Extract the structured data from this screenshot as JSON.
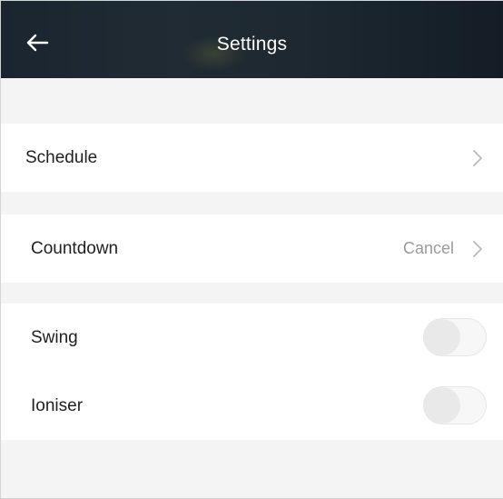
{
  "header": {
    "title": "Settings",
    "back_icon": "arrow-left-icon",
    "background": "#1d2830"
  },
  "rows": {
    "schedule": {
      "label": "Schedule",
      "chevron_icon": "chevron-right-icon"
    },
    "countdown": {
      "label": "Countdown",
      "value": "Cancel",
      "chevron_icon": "chevron-right-icon"
    }
  },
  "toggles": {
    "swing": {
      "label": "Swing",
      "state": "off"
    },
    "ioniser": {
      "label": "Ioniser",
      "state": "off"
    }
  },
  "colors": {
    "page_background": "#f4f4f4",
    "row_background": "#ffffff",
    "value_text": "#9b9b9b",
    "toggle_off": "#e9e9e9"
  }
}
